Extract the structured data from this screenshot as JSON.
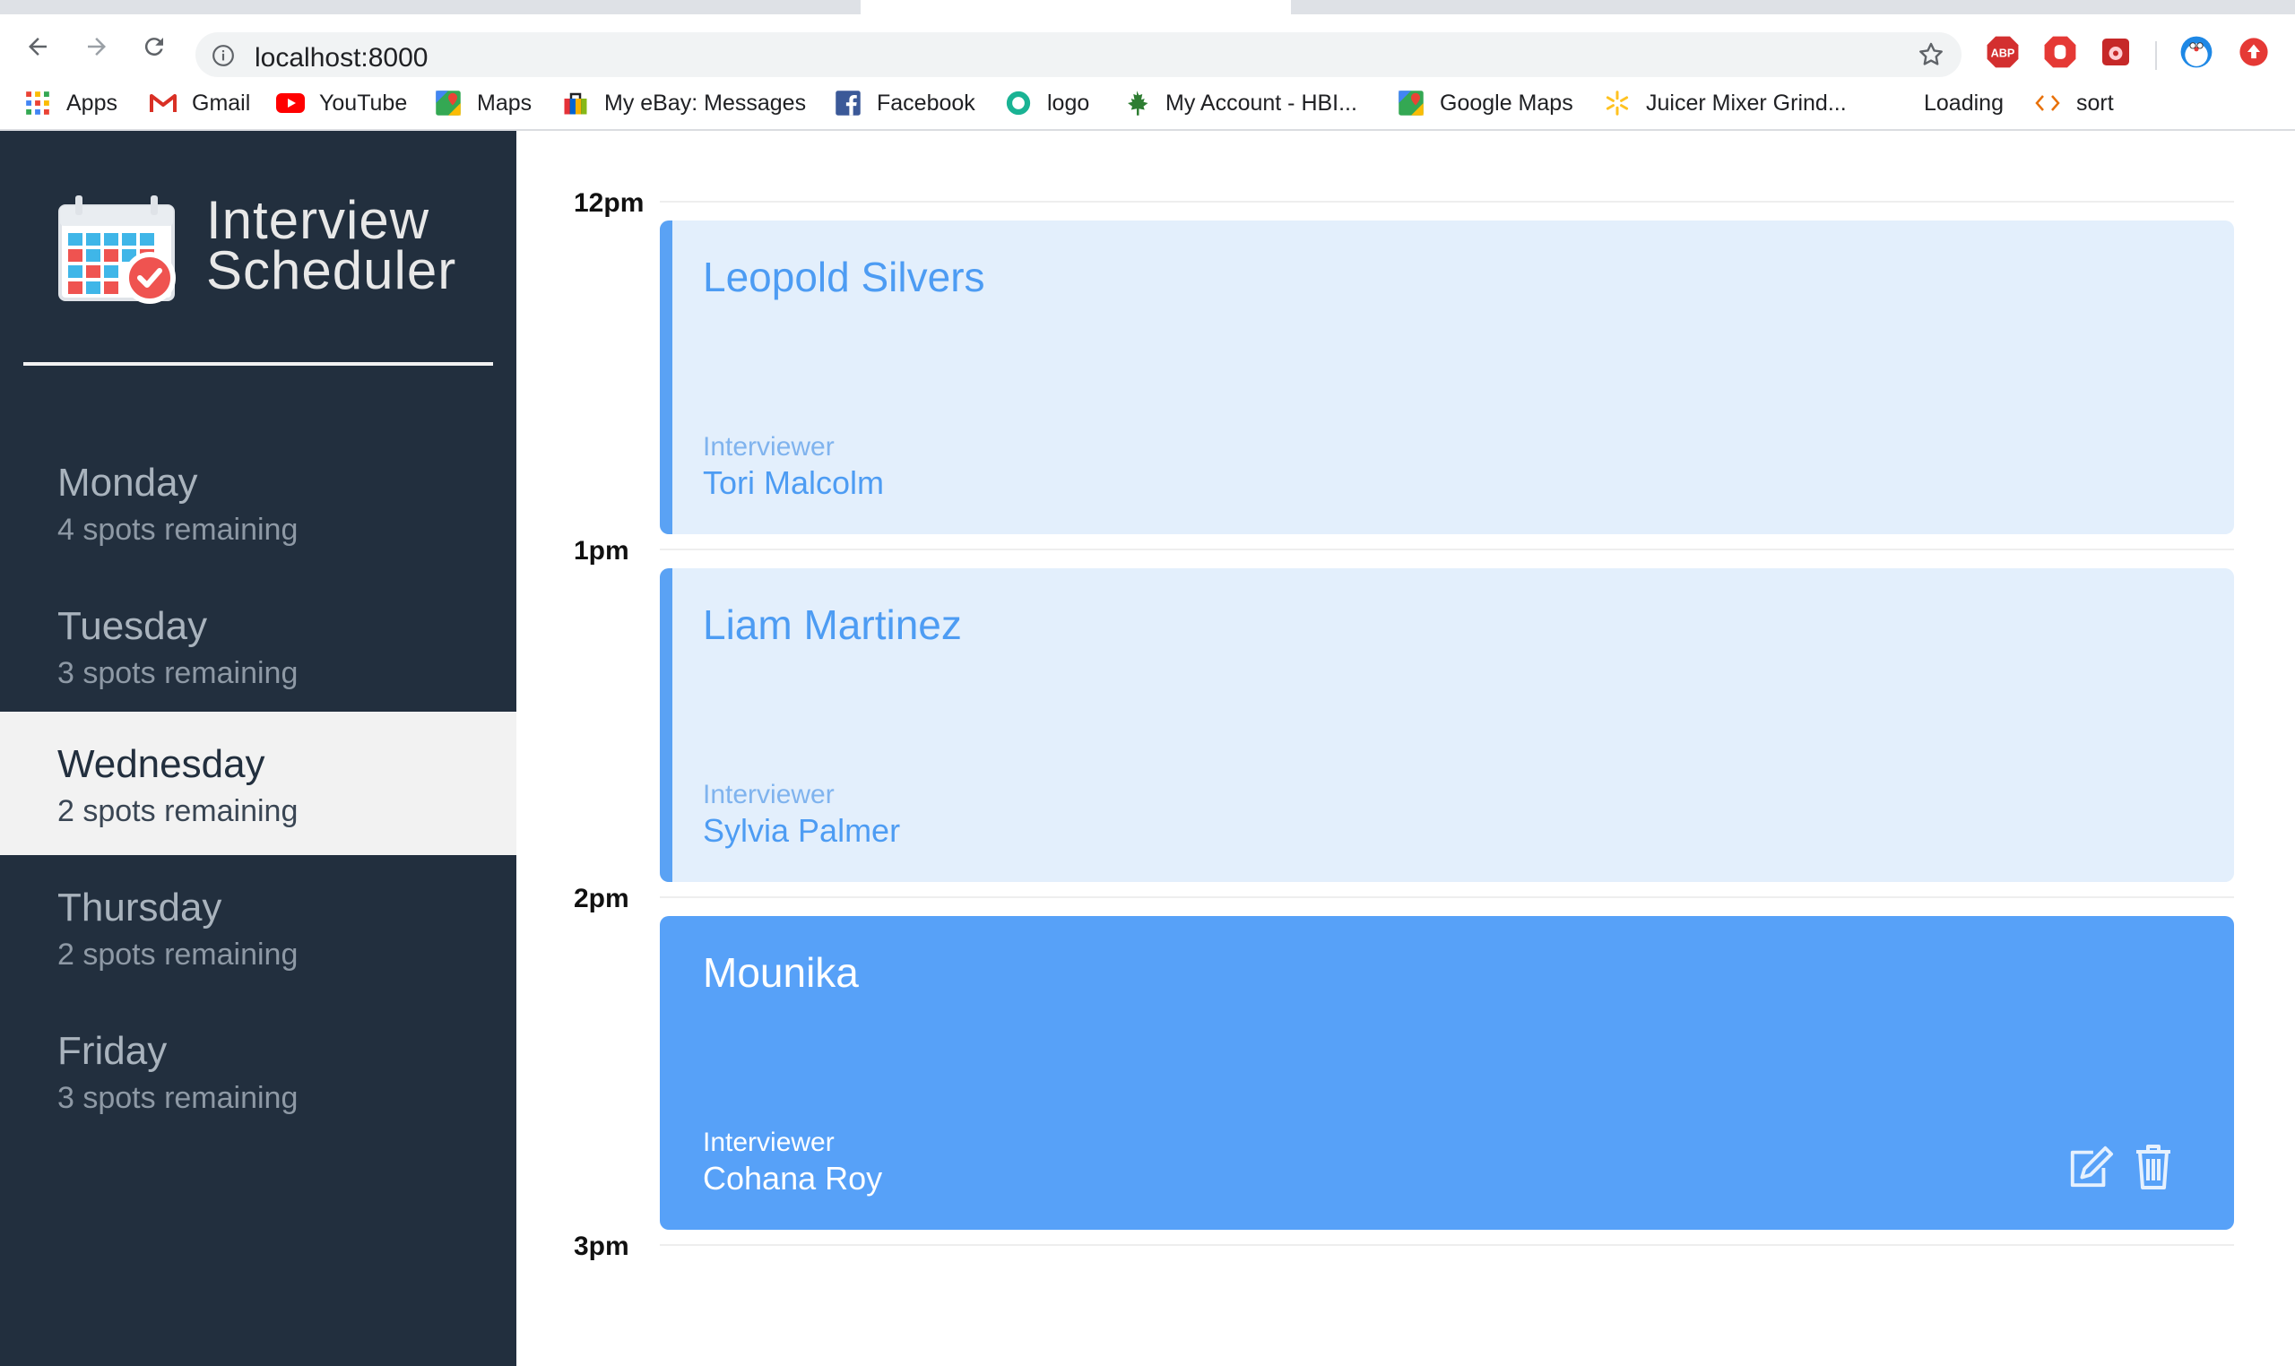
{
  "browser": {
    "url": "localhost:8000",
    "bookmarks": [
      {
        "label": "Apps",
        "icon": "apps-grid-icon"
      },
      {
        "label": "Gmail",
        "icon": "gmail-icon"
      },
      {
        "label": "YouTube",
        "icon": "youtube-icon"
      },
      {
        "label": "Maps",
        "icon": "maps-icon"
      },
      {
        "label": "My eBay: Messages",
        "icon": "ebay-icon"
      },
      {
        "label": "Facebook",
        "icon": "facebook-icon"
      },
      {
        "label": "logo",
        "icon": "logo-ring-icon"
      },
      {
        "label": "My Account - HBI...",
        "icon": "maple-leaf-icon"
      },
      {
        "label": "Google Maps",
        "icon": "maps-icon"
      },
      {
        "label": "Juicer Mixer Grind...",
        "icon": "walmart-spark-icon"
      },
      {
        "label": "Loading",
        "icon": ""
      },
      {
        "label": "sort",
        "icon": "code-brackets-icon"
      }
    ],
    "extensions": [
      "adblock-icon",
      "stop-hand-icon",
      "bug-extension-icon",
      "doraemon-icon",
      "red-upload-icon"
    ]
  },
  "sidebar": {
    "brand_line1": "Interview",
    "brand_line2": "Scheduler",
    "days": [
      {
        "name": "Monday",
        "spots": "4 spots remaining",
        "selected": false
      },
      {
        "name": "Tuesday",
        "spots": "3 spots remaining",
        "selected": false
      },
      {
        "name": "Wednesday",
        "spots": "2 spots remaining",
        "selected": true
      },
      {
        "name": "Thursday",
        "spots": "2 spots remaining",
        "selected": false
      },
      {
        "name": "Friday",
        "spots": "3 spots remaining",
        "selected": false
      }
    ]
  },
  "schedule": {
    "times": [
      "12pm",
      "1pm",
      "2pm",
      "3pm"
    ],
    "appointments": [
      {
        "student": "Leopold Silvers",
        "interviewer_label": "Interviewer",
        "interviewer": "Tori Malcolm",
        "state": "light"
      },
      {
        "student": "Liam Martinez",
        "interviewer_label": "Interviewer",
        "interviewer": "Sylvia Palmer",
        "state": "light"
      },
      {
        "student": "Mounika",
        "interviewer_label": "Interviewer",
        "interviewer": "Cohana Roy",
        "state": "hover"
      }
    ]
  },
  "colors": {
    "sidebar_bg": "#222f3e",
    "appointment_light": "#e3effc",
    "appointment_accent": "#5aa2f4",
    "appointment_solid": "#57a1f8"
  }
}
